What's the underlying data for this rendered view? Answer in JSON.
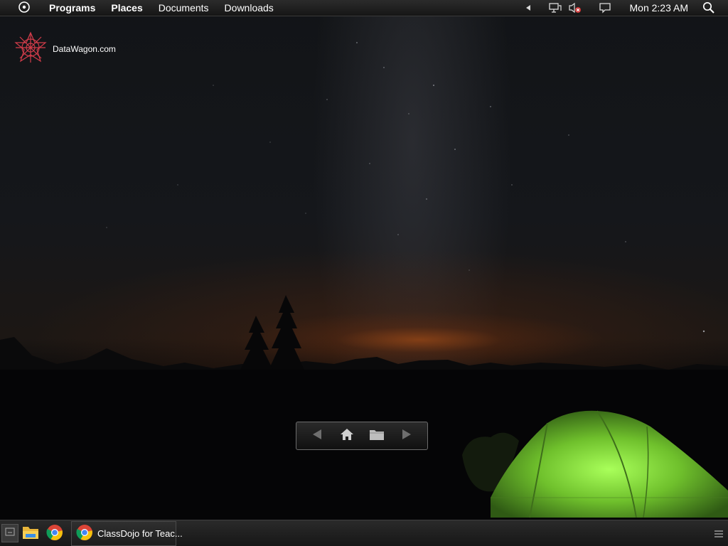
{
  "top_panel": {
    "menu_items": [
      "Programs",
      "Places",
      "Documents",
      "Downloads"
    ],
    "clock": "Mon 2:23 AM",
    "tray_icons": [
      "show-hidden-arrow-icon",
      "network-icon",
      "volume-muted-icon",
      "notification-icon",
      "search-icon"
    ]
  },
  "desktop": {
    "icons": [
      {
        "label": "DataWagon.com",
        "icon": "datawagon-logo-icon"
      }
    ]
  },
  "nav_widget": {
    "buttons": [
      "back-arrow-icon",
      "home-icon",
      "folder-icon",
      "forward-arrow-icon"
    ]
  },
  "taskbar": {
    "quick_launch": [
      "file-manager-icon",
      "chrome-icon"
    ],
    "tasks": [
      {
        "label": "ClassDojo for Teac...",
        "icon": "chrome-icon"
      }
    ]
  },
  "colors": {
    "panel_bg": "#1e1e1e",
    "logo_red": "#d23c4a",
    "tent_green": "#7dd43a",
    "chrome_red": "#db4437",
    "chrome_yellow": "#f4c20d",
    "chrome_green": "#0f9d58",
    "chrome_blue": "#4285f4"
  }
}
